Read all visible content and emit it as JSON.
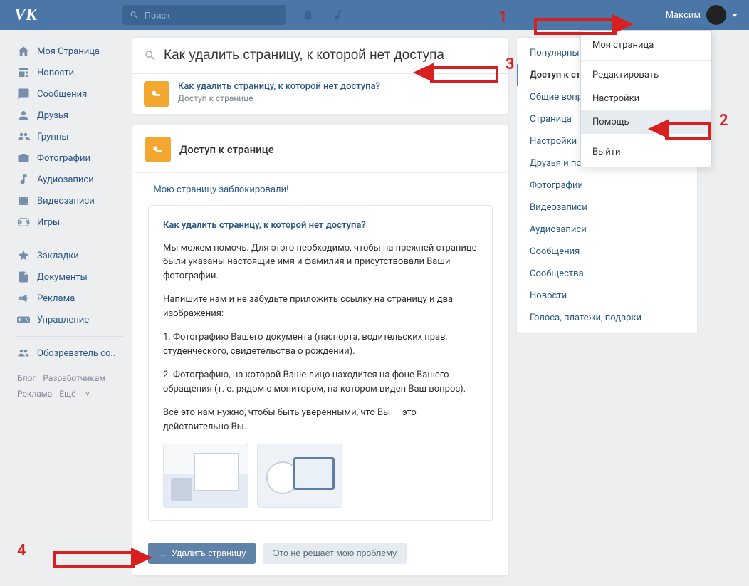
{
  "header": {
    "search_placeholder": "Поиск",
    "user_name": "Максим"
  },
  "left_nav": {
    "items": [
      {
        "label": "Моя Страница"
      },
      {
        "label": "Новости"
      },
      {
        "label": "Сообщения"
      },
      {
        "label": "Друзья"
      },
      {
        "label": "Группы"
      },
      {
        "label": "Фотографии"
      },
      {
        "label": "Аудиозаписи"
      },
      {
        "label": "Видеозаписи"
      },
      {
        "label": "Игры"
      }
    ],
    "secondary": [
      {
        "label": "Закладки"
      },
      {
        "label": "Документы"
      },
      {
        "label": "Реклама"
      },
      {
        "label": "Управление"
      }
    ],
    "tertiary": [
      {
        "label": "Обозреватель со.."
      }
    ],
    "footer": {
      "blog": "Блог",
      "devs": "Разработчикам",
      "ads": "Реклама",
      "more": "Ещё"
    }
  },
  "help_search": {
    "value": "Как удалить страницу, к которой нет доступа"
  },
  "suggestion": {
    "title": "Как удалить страницу, к которой нет доступа?",
    "sub": "Доступ к странице"
  },
  "section": {
    "title": "Доступ к странице",
    "blocked_link": "Мою страницу заблокировали!"
  },
  "article": {
    "q": "Как удалить страницу, к которой нет доступа?",
    "p1": "Мы можем помочь. Для этого необходимо, чтобы на прежней странице были указаны настоящие имя и фамилия и присутствовали Ваши фотографии.",
    "p2": "Напишите нам и не забудьте приложить ссылку на страницу и два изображения:",
    "p3": "1. Фотографию Вашего документа (паспорта, водительских прав, студенческого, свидетельства о рождении).",
    "p4": "2. Фотографию, на которой Ваше лицо находится на фоне Вашего обращения (т. е. рядом с монитором, на котором виден Ваш вопрос).",
    "p5": "Всё это нам нужно, чтобы быть уверенными, что Вы — это действительно Вы."
  },
  "actions": {
    "delete": "Удалить страницу",
    "not_solved": "Это не решает мою проблему"
  },
  "right_nav": [
    {
      "label": "Популярные",
      "active": false
    },
    {
      "label": "Доступ к странице",
      "active": true
    },
    {
      "label": "Общие вопросы",
      "active": false
    },
    {
      "label": "Страница",
      "active": false
    },
    {
      "label": "Настройки приватности",
      "active": false
    },
    {
      "label": "Друзья и подписчики",
      "active": false
    },
    {
      "label": "Фотографии",
      "active": false
    },
    {
      "label": "Видеозаписи",
      "active": false
    },
    {
      "label": "Аудиозаписи",
      "active": false
    },
    {
      "label": "Сообщения",
      "active": false
    },
    {
      "label": "Сообщества",
      "active": false
    },
    {
      "label": "Новости",
      "active": false
    },
    {
      "label": "Голоса, платежи, подарки",
      "active": false
    }
  ],
  "dropdown": {
    "my_page": "Моя страница",
    "edit": "Редактировать",
    "settings": "Настройки",
    "help": "Помощь",
    "logout": "Выйти"
  },
  "annotations": {
    "a1": "1",
    "a2": "2",
    "a3": "3",
    "a4": "4"
  }
}
